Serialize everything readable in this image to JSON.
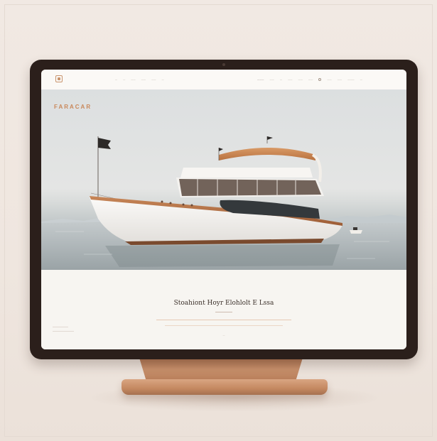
{
  "brand": {
    "logo_icon": "boat-logo-icon"
  },
  "hero": {
    "title": "FARACAR"
  },
  "content": {
    "kicker": "",
    "heading": "Stoahiont Hoyr Elohlolt E Lssa",
    "side_label": ""
  },
  "colors": {
    "accent": "#c9885a",
    "bezel": "#2b1f1b",
    "stand": "#c48860",
    "background": "#efe6df"
  }
}
